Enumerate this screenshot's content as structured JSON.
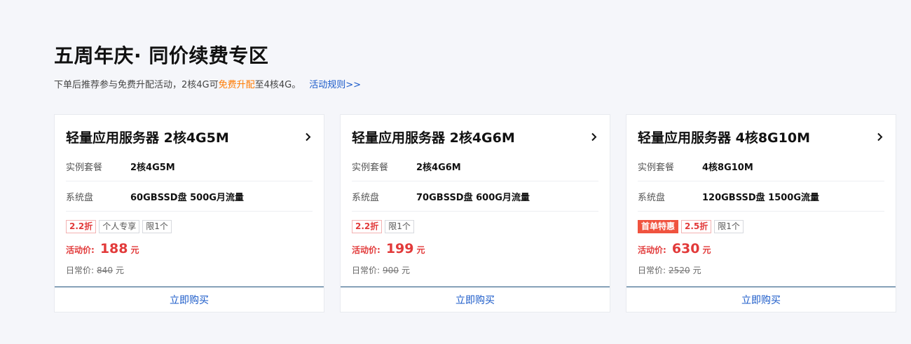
{
  "header": {
    "title": "五周年庆· 同价续费专区",
    "subtitle_prefix": "下单后推荐参与免费升配活动，2核4G可",
    "subtitle_highlight": "免费升配",
    "subtitle_suffix": "至4核4G。",
    "rules_link": "活动规则>>"
  },
  "labels": {
    "instance": "实例套餐",
    "disk": "系统盘",
    "promo_price": "活动价:",
    "regular_price": "日常价:",
    "currency": "元",
    "buy": "立即购买"
  },
  "colors": {
    "accent_red": "#e23a3a",
    "highlight_orange": "#ff7a00",
    "link_blue": "#1a5ac9",
    "first_order_badge": "#f0533f"
  },
  "cards": [
    {
      "title": "轻量应用服务器 2核4G5M",
      "instance": "2核4G5M",
      "disk": "60GBSSD盘 500G月流量",
      "tags": [
        {
          "text": "2.2折",
          "kind": "disc"
        },
        {
          "text": "个人专享",
          "kind": "plain"
        },
        {
          "text": "限1个",
          "kind": "plain"
        }
      ],
      "price": "188",
      "original": "840"
    },
    {
      "title": "轻量应用服务器 2核4G6M",
      "instance": "2核4G6M",
      "disk": "70GBSSD盘 600G月流量",
      "tags": [
        {
          "text": "2.2折",
          "kind": "disc"
        },
        {
          "text": "限1个",
          "kind": "plain"
        }
      ],
      "price": "199",
      "original": "900"
    },
    {
      "title": "轻量应用服务器 4核8G10M",
      "instance": "4核8G10M",
      "disk": "120GBSSD盘 1500G流量",
      "tags": [
        {
          "text": "首单特惠",
          "kind": "first"
        },
        {
          "text": "2.5折",
          "kind": "disc"
        },
        {
          "text": "限1个",
          "kind": "plain"
        }
      ],
      "price": "630",
      "original": "2520"
    }
  ]
}
